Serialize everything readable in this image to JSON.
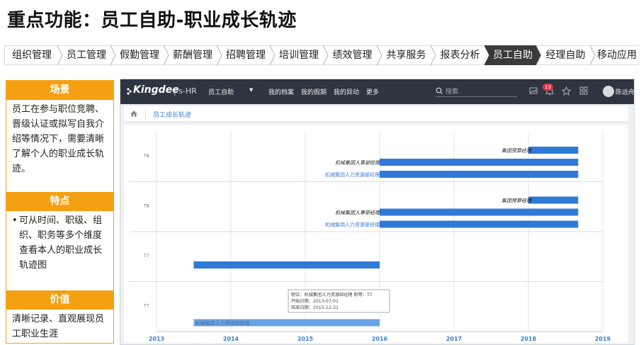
{
  "title": "重点功能：员工自助-职业成长轨迹",
  "nav": {
    "items": [
      "组织管理",
      "员工管理",
      "假勤管理",
      "薪酬管理",
      "招聘管理",
      "培训管理",
      "绩效管理",
      "共享服务",
      "报表分析",
      "员工自助",
      "经理自助",
      "移动应用"
    ],
    "active_index": 9,
    "active_color": "#3a3a3a"
  },
  "panels": {
    "scene_title": "场景",
    "scene_text": "员工在参与职位竞聘、晋级认证或拟写自我介绍等情况下，需要清晰了解个人的职业成长轨迹。",
    "feature_title": "特点",
    "feature_text": "可从时间、职级、组织、职务等多个维度查看本人的职业成长轨迹图",
    "value_title": "价值",
    "value_text": "清晰记录、直观展现员工职业生涯",
    "header_color": "#f5a011"
  },
  "app": {
    "logo": "Kingdee",
    "product": "s-HR",
    "menu": [
      "员工自助",
      "我的档案",
      "我的假期",
      "我的异动",
      "更多"
    ],
    "search_placeholder": "搜索",
    "notification_count": "13",
    "username": "陈远舟",
    "breadcrumb": "员工成长轨迹",
    "icons": [
      "search-icon",
      "image-icon",
      "bell-icon",
      "star-icon",
      "grid-icon",
      "user-avatar-icon",
      "home-icon"
    ]
  },
  "chart_data": {
    "type": "bar",
    "orientation": "horizontal-timeline",
    "x_ticks": [
      "2013",
      "2014",
      "2015",
      "2016",
      "2017",
      "2018",
      "2019"
    ],
    "xlim": [
      2013,
      2019
    ],
    "grid": true,
    "bar_color": "#2f7ad8",
    "rows": [
      {
        "grade": "T8",
        "bars": [
          {
            "label": "集团预算经理",
            "start": 2018.0,
            "end": 2018.67
          },
          {
            "label": "机械集团人事部经理",
            "start": 2016.0,
            "end": 2018.67
          },
          {
            "label": "机械集团人力资源部经理",
            "start": 2016.0,
            "end": 2018.67
          }
        ]
      },
      {
        "grade": "T8",
        "bars": [
          {
            "label": "集团预算经理",
            "start": 2018.0,
            "end": 2018.67
          },
          {
            "label": "机械集团人事部经理",
            "start": 2016.0,
            "end": 2018.67
          },
          {
            "label": "机械集团人力资源部经理",
            "start": 2016.0,
            "end": 2018.67
          }
        ]
      },
      {
        "grade": "T7",
        "bars": [
          {
            "label": "",
            "start": 2013.5,
            "end": 2016.0
          }
        ]
      },
      {
        "grade": "T7",
        "bars": [
          {
            "label": "机械集团人力资源部经理",
            "start": 2013.5,
            "end": 2016.0
          }
        ]
      }
    ],
    "tooltip": {
      "lines": [
        "职位：机械集团人力资源部经理 职等：T7",
        "开始日期：2013-07-01",
        "结束日期：2015-12-31"
      ]
    }
  }
}
